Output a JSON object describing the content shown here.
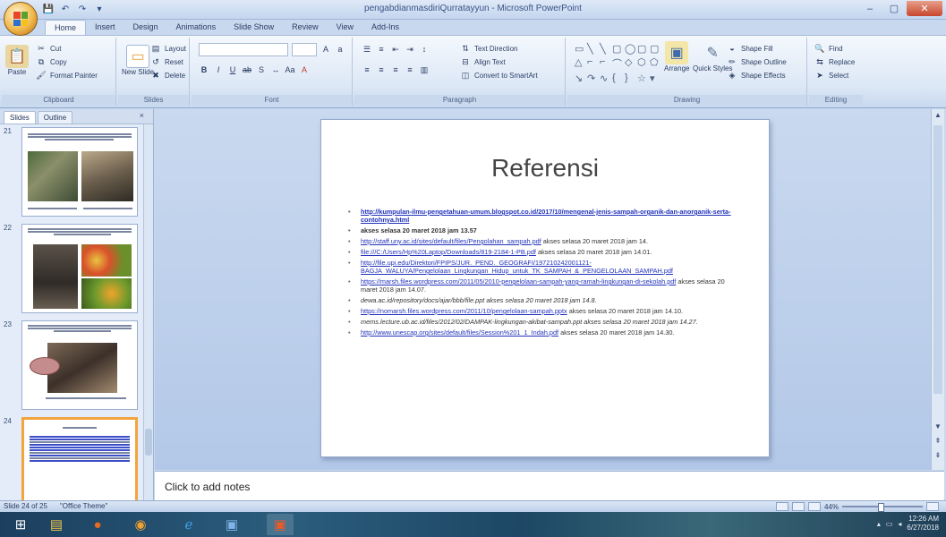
{
  "window": {
    "title": "pengabdianmasdiriQurratayyun - Microsoft PowerPoint",
    "minimize": "–",
    "maximize": "▢",
    "close": "✕"
  },
  "qat": [
    "💾",
    "↶",
    "↷",
    "▾"
  ],
  "ribbon_tabs": [
    "Home",
    "Insert",
    "Design",
    "Animations",
    "Slide Show",
    "Review",
    "View",
    "Add-Ins"
  ],
  "ribbon": {
    "clipboard": {
      "label": "Clipboard",
      "paste": "Paste",
      "cut": "Cut",
      "copy": "Copy",
      "format_painter": "Format Painter"
    },
    "slides": {
      "label": "Slides",
      "new_slide": "New Slide",
      "layout": "Layout",
      "reset": "Reset",
      "delete": "Delete"
    },
    "font": {
      "label": "Font"
    },
    "paragraph": {
      "label": "Paragraph",
      "text_direction": "Text Direction",
      "align_text": "Align Text",
      "convert_smartart": "Convert to SmartArt"
    },
    "drawing": {
      "label": "Drawing",
      "arrange": "Arrange",
      "quick_styles": "Quick Styles",
      "shape_fill": "Shape Fill",
      "shape_outline": "Shape Outline",
      "shape_effects": "Shape Effects"
    },
    "editing": {
      "label": "Editing",
      "find": "Find",
      "replace": "Replace",
      "select": "Select"
    }
  },
  "panel": {
    "tabs": [
      "Slides",
      "Outline"
    ],
    "close": "×",
    "slide_numbers": [
      "21",
      "22",
      "23",
      "24"
    ]
  },
  "slide": {
    "title": "Referensi",
    "references": [
      {
        "link": "http://kumpulan-ilmu-pengetahuan-umum.blogspot.co.id/2017/10/mengenal-jenis-sampah-organik-dan-anorganik-serta-contohnya.html",
        "text": "",
        "style": "bold"
      },
      {
        "link": "",
        "text": "akses selasa 20 maret 2018 jam 13.57",
        "style": "bold"
      },
      {
        "link": "http://staff.uny.ac.id/sites/default/files/Pengolahan_sampah.pdf",
        "text": " akses selasa 20 maret 2018 jam 14.",
        "style": "normal"
      },
      {
        "link": "file:///C:/Users/Hp%20Laptop/Downloads/819-2184-1-PB.pdf",
        "text": " akses selasa 20 maret 2018 jam 14.01.",
        "style": "normal"
      },
      {
        "link": "http://file.upi.edu/Direktori/FPIPS/JUR._PEND._GEOGRAFI/197210242001121-BAGJA_WALUYA/Pengelolaan_Lingkungan_Hidup_untuk_TK_SAMPAH_&_PENGELOLAAN_SAMPAH.pdf",
        "text": "",
        "style": "normal"
      },
      {
        "link": "https://marsh.files.wordpress.com/2011/05/2010-pengelolaan-sampah-yang-ramah-lingkungan-di-sekolah.pdf",
        "text": " akses selasa 20 maret 2018 jam 14.07.",
        "style": "normal"
      },
      {
        "link": "",
        "text": "dewa.ac.id/repository/docs/ajar/bbb/file.ppt akses selasa 20 maret 2018 jam 14.8.",
        "style": "italic"
      },
      {
        "link": "https://nomarsh.files.wordpress.com/2011/10/pengelolaan-sampah.pptx",
        "text": " akses selasa 20 maret 2018 jam 14.10.",
        "style": "normal"
      },
      {
        "link": "",
        "text": "mems.lecture.ub.ac.id/files/2012/02/DAMPAK-lingkungan-akibat-sampah.ppt akses selasa 20 maret 2018 jam 14.27.",
        "style": "italic"
      },
      {
        "link": "http://www.unescap.org/sites/default/files/Session%201_1_Indah.pdf",
        "text": " akses selasa 20 maret 2018 jam 14.30.",
        "style": "normal"
      }
    ]
  },
  "notes_placeholder": "Click to add notes",
  "status": {
    "slide": "Slide 24 of 25",
    "theme": "\"Office Theme\"",
    "zoom": "44%"
  },
  "taskbar": {
    "time": "12:26 AM",
    "date": "6/27/2018"
  },
  "colors": {
    "accent": "#f3a43d",
    "link": "#2233bb",
    "ribbon": "#dde8f6"
  }
}
